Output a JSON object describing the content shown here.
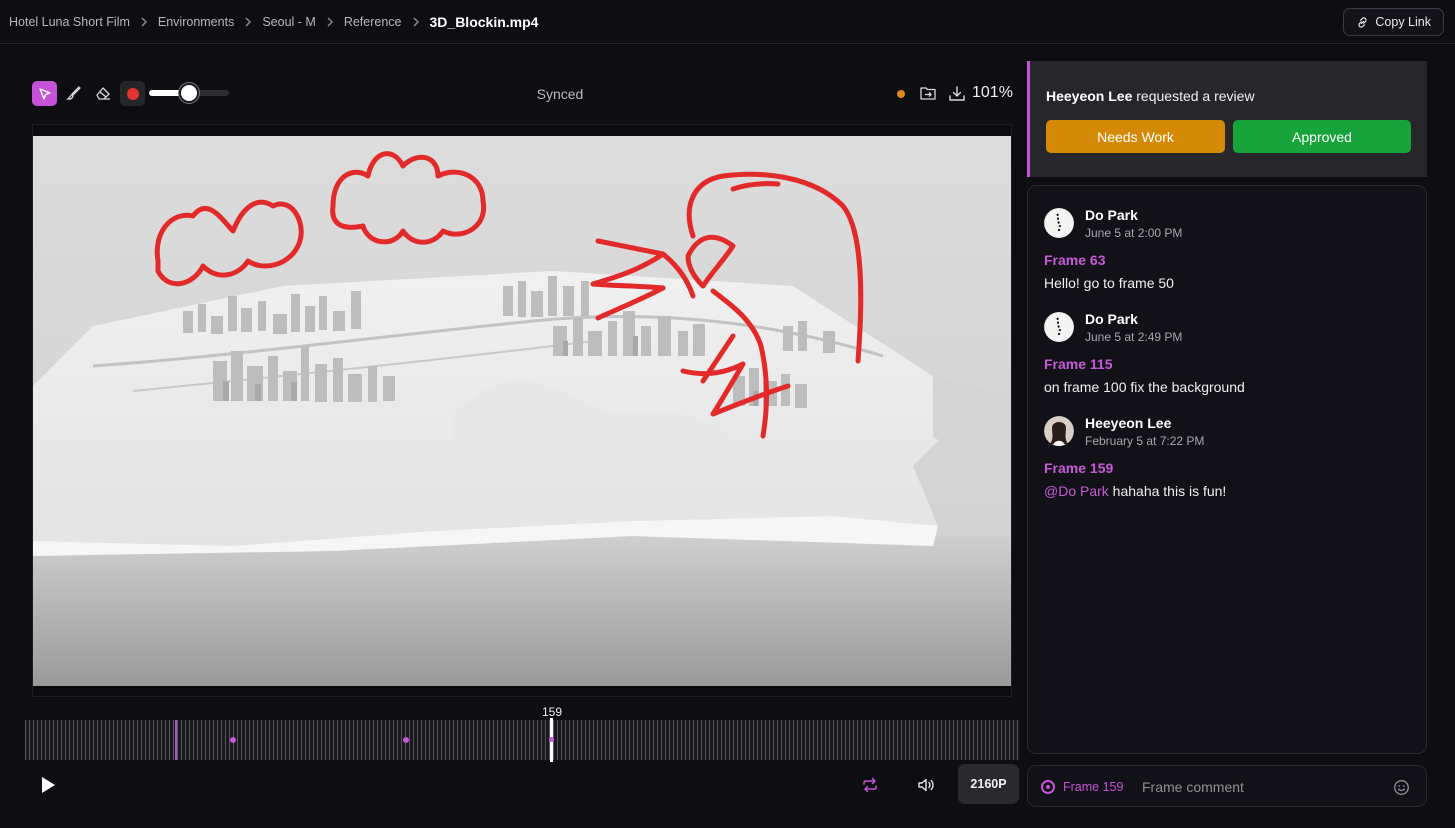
{
  "breadcrumb": {
    "items": [
      "Hotel Luna Short Film",
      "Environments",
      "Seoul - M",
      "Reference"
    ],
    "current": "3D_Blockin.mp4"
  },
  "header": {
    "copy_link_label": "Copy Link"
  },
  "toolbar": {
    "active_tool": "pointer",
    "brush_color": "#e2342f",
    "brush_size_fraction": 0.5,
    "sync_status": "Synced",
    "status_dot_color": "#e08a1e",
    "zoom": "101%"
  },
  "player": {
    "current_frame": "159",
    "comment_markers": [
      63,
      115,
      159
    ],
    "play_icon": "play-icon",
    "loop_icon": "loop-icon",
    "volume_icon": "volume-icon",
    "resolution": "2160P"
  },
  "review": {
    "requester": "Heeyeon Lee",
    "message": " requested a review",
    "needs_work_label": "Needs Work",
    "approved_label": "Approved",
    "colors": {
      "needs_work": "#d48a06",
      "approved": "#17a43b",
      "accent": "#c552d8"
    }
  },
  "comments": [
    {
      "author": "Do Park",
      "time": "June 5 at 2:00 PM",
      "frame": "Frame 63",
      "text": "Hello! go to frame 50"
    },
    {
      "author": "Do Park",
      "time": "June 5 at 2:49 PM",
      "frame": "Frame 115",
      "text": "on frame 100 fix the background"
    },
    {
      "author": "Heeyeon Lee",
      "time": "February 5 at 7:22 PM",
      "frame": "Frame 159",
      "mention": "@Do Park",
      "text": " hahaha this is fun!"
    }
  ],
  "comment_input": {
    "frame_label": "Frame 159",
    "placeholder": "Frame comment",
    "emoji_icon": "smiley-icon"
  }
}
